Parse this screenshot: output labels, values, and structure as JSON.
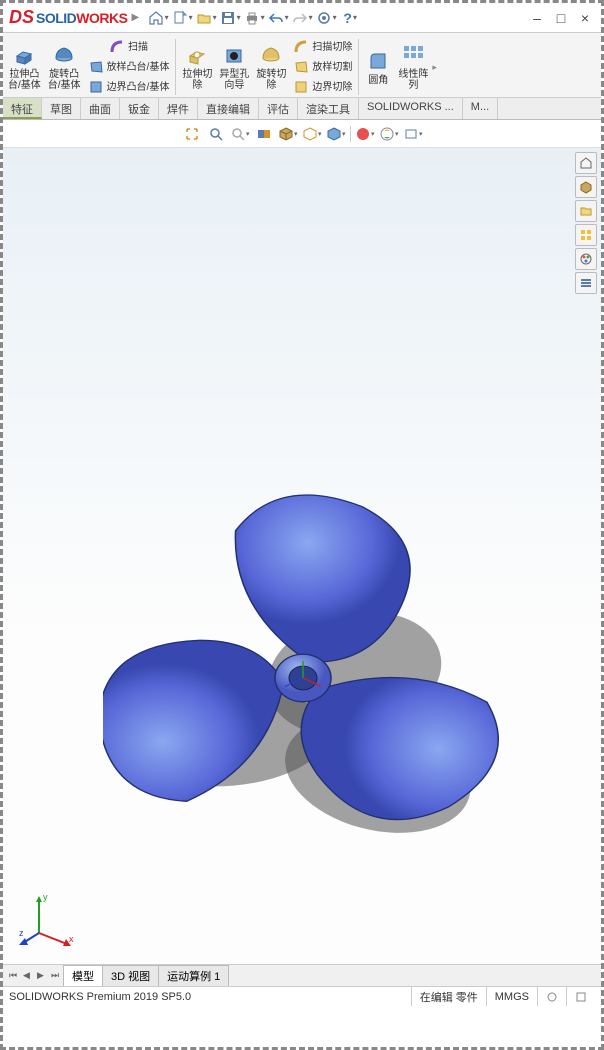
{
  "title": {
    "brand_solid": "SOLID",
    "brand_works": "WORKS"
  },
  "window": {
    "min": "–",
    "max": "□",
    "close": "×"
  },
  "ribbon": {
    "extrude": "拉伸凸\n台/基体",
    "revolve": "旋转凸\n台/基体",
    "sweep": "扫描",
    "loft": "放样凸台/基体",
    "boundary": "边界凸台/基体",
    "extrudecut": "拉伸切\n除",
    "holewiz": "异型孔\n向导",
    "revolvecut": "旋转切\n除",
    "sweepcut": "扫描切除",
    "loftcut": "放样切割",
    "boundarycut": "边界切除",
    "fillet": "圆角",
    "linearpattern": "线性阵\n列"
  },
  "tabs": [
    "特征",
    "草图",
    "曲面",
    "钣金",
    "焊件",
    "直接编辑",
    "评估",
    "渲染工具",
    "SOLIDWORKS ...",
    "M..."
  ],
  "bottomtabs": [
    "模型",
    "3D 视图",
    "运动算例 1"
  ],
  "status": {
    "version": "SOLIDWORKS Premium 2019 SP5.0",
    "edit": "在编辑 零件",
    "units": "MMGS"
  },
  "triad": {
    "x": "x",
    "y": "y",
    "z": "z"
  }
}
